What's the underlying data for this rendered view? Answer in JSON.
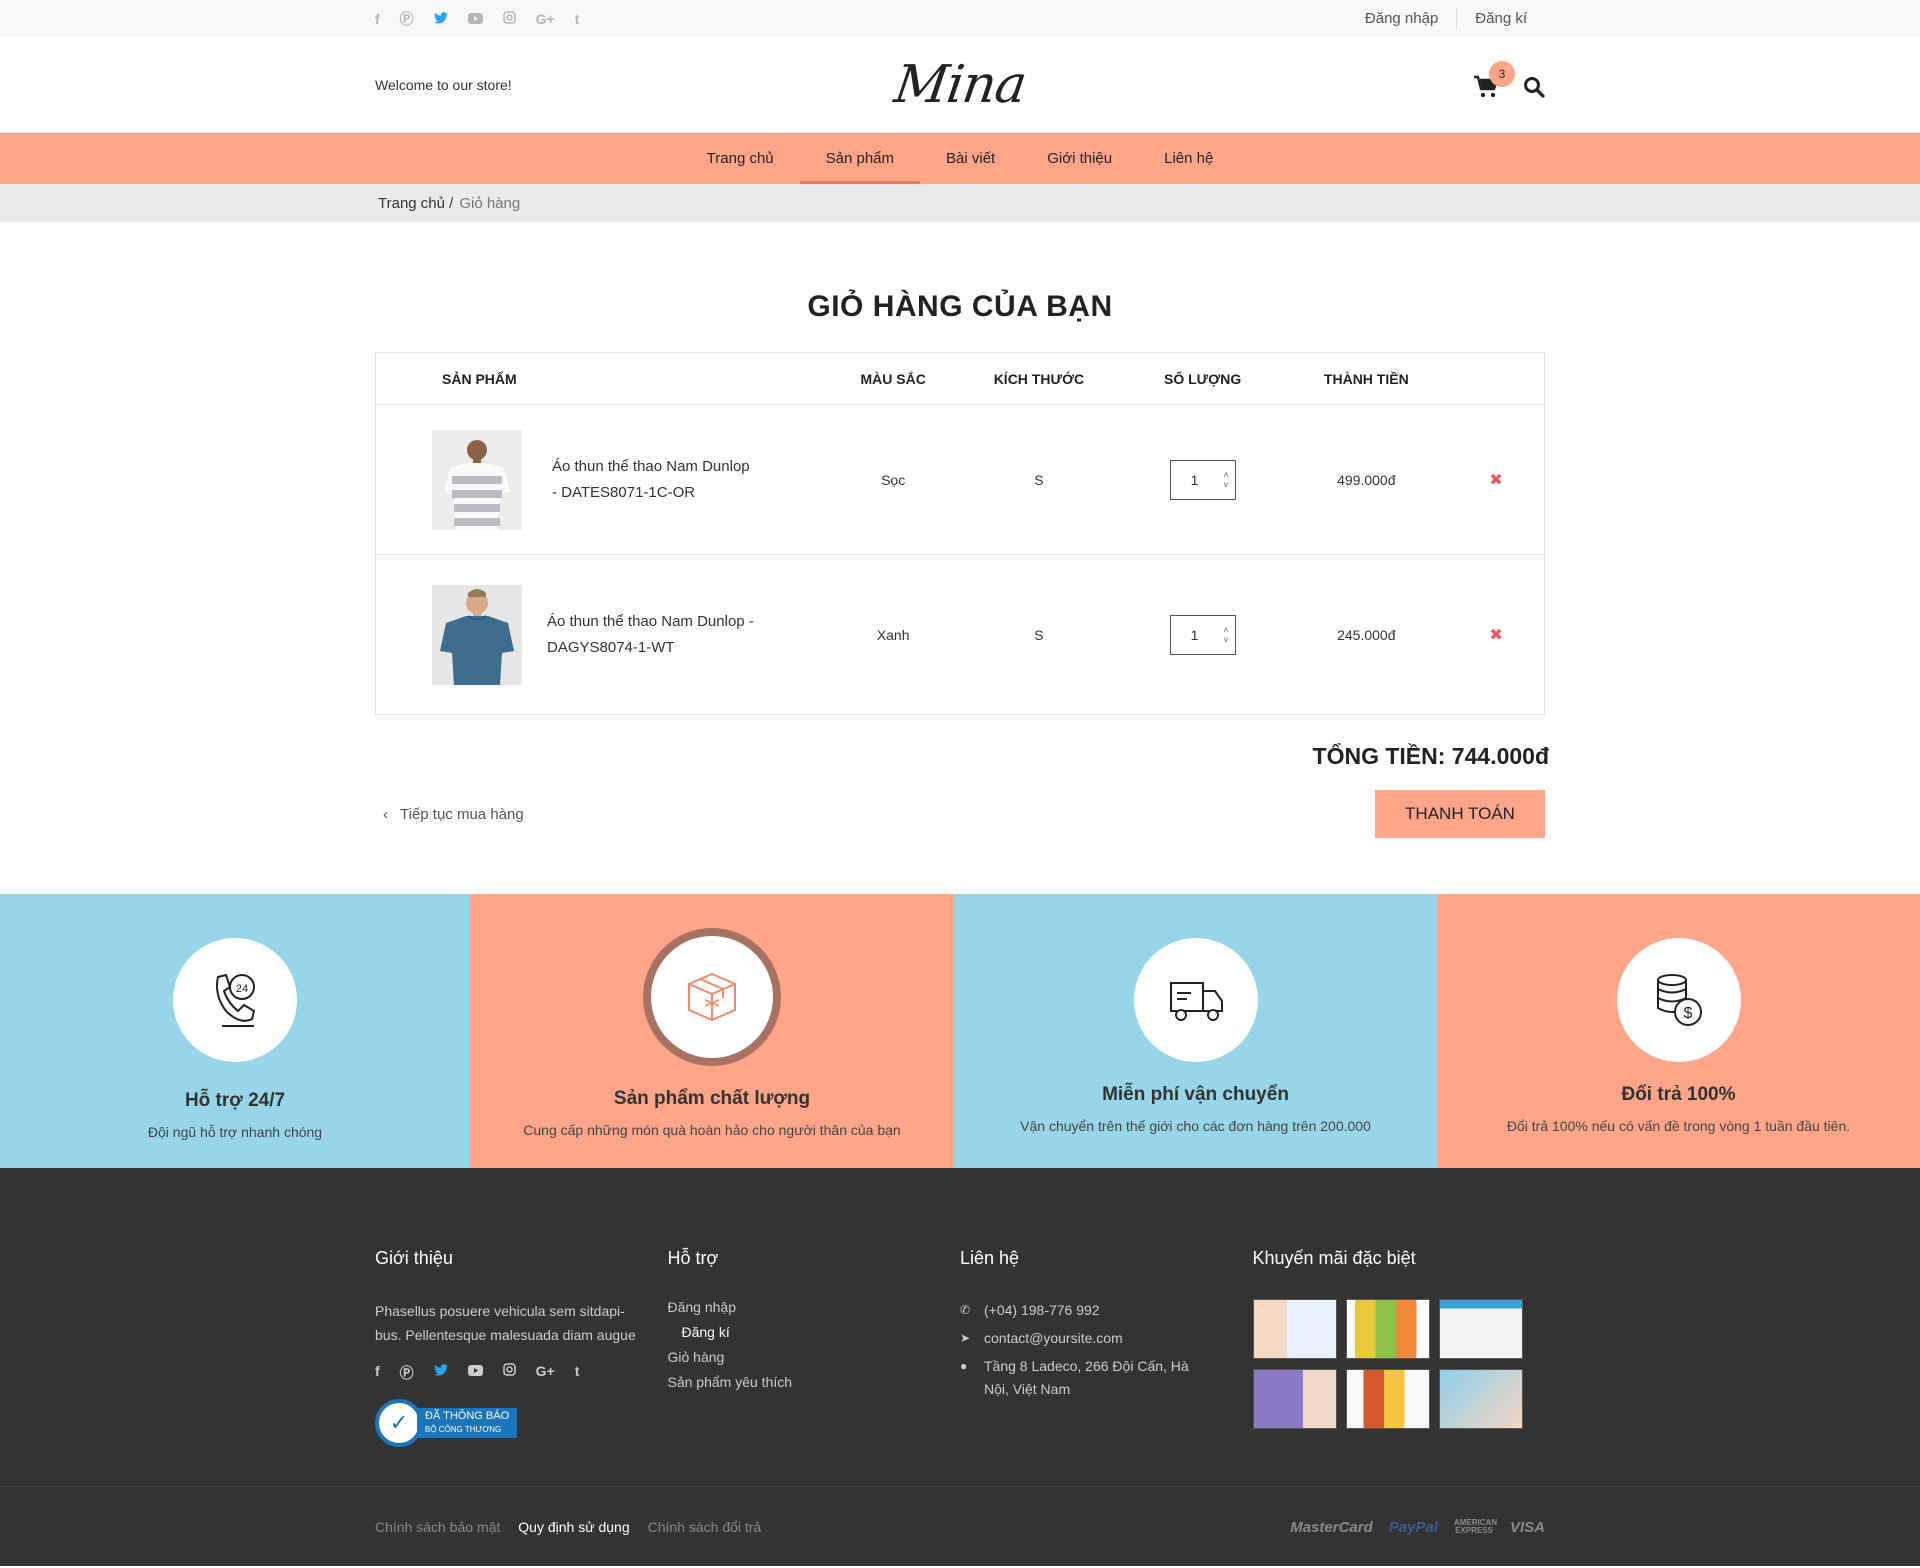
{
  "topbar": {
    "social_icons": [
      "facebook-icon",
      "pinterest-icon",
      "twitter-icon",
      "youtube-icon",
      "instagram-icon",
      "google-plus-icon",
      "tumblr-icon"
    ],
    "login": "Đăng nhập",
    "register": "Đăng kí"
  },
  "header": {
    "welcome": "Welcome to our store!",
    "logo": "Mina",
    "cart_count": "3"
  },
  "nav": {
    "items": [
      "Trang chủ",
      "Sản phẩm",
      "Bài viết",
      "Giới thiệu",
      "Liên hệ"
    ],
    "active": "Sản phẩm"
  },
  "breadcrumb": {
    "home": "Trang chủ /",
    "current": "Giỏ hàng"
  },
  "cart": {
    "title": "GIỎ HÀNG CỦA BẠN",
    "headers": {
      "product": "SẢN PHẨM",
      "color": "MÀU SẮC",
      "size": "KÍCH THƯỚC",
      "qty": "SỐ LƯỢNG",
      "total": "THÀNH TIỀN"
    },
    "rows": [
      {
        "name": "Áo thun thể thao Nam Dunlop - DATES8071-1C-OR",
        "color": "Sọc",
        "size": "S",
        "qty": "1",
        "price": "499.000đ"
      },
      {
        "name": "Áo thun thể thao Nam Dunlop - DAGYS8074-1-WT",
        "color": "Xanh",
        "size": "S",
        "qty": "1",
        "price": "245.000đ"
      }
    ],
    "total": "TỔNG TIỀN: 744.000đ",
    "continue": "Tiếp tục mua hàng",
    "checkout": "THANH TOÁN"
  },
  "features": [
    {
      "title": "Hỗ trợ 24/7",
      "desc": "Đội ngũ hỗ trợ nhanh chóng"
    },
    {
      "title": "Sản phẩm chất lượng",
      "desc": "Cung cấp những món quà hoàn hảo cho người thân của bạn"
    },
    {
      "title": "Miễn phí vận chuyển",
      "desc": "Vận chuyển trên thế giới cho các đơn hàng trên  200.000"
    },
    {
      "title": "Đổi trả 100%",
      "desc": "Đổi trả 100% nếu có vấn đề trong vòng 1 tuần đầu tiên."
    }
  ],
  "footer": {
    "about": {
      "title": "Giới thiệu",
      "text": "Phasellus posuere vehicula sem sitdapi-bus. Pellentesque malesuada diam augue",
      "badge_main": "ĐÃ THÔNG BÁO",
      "badge_sub": "BỘ CÔNG THƯƠNG"
    },
    "support": {
      "title": "Hỗ trợ",
      "links": [
        "Đăng nhập",
        "Đăng kí",
        "Giỏ hàng",
        "Sản phẩm yêu thích"
      ]
    },
    "contact": {
      "title": "Liên hệ",
      "phone": "(+04) 198-776 992",
      "email": "contact@yoursite.com",
      "address": "Tầng 8 Ladeco, 266 Đội Cấn, Hà Nội, Việt Nam"
    },
    "promo": {
      "title": "Khuyến mãi đặc biệt"
    },
    "policies": [
      "Chính sách bảo mật",
      "Quy định sử dụng",
      "Chính sách đổi trả"
    ],
    "payments": [
      "MasterCard",
      "PayPal",
      "AMERICAN EXPRESS",
      "VISA"
    ]
  },
  "colors": {
    "accent": "#ffa589",
    "light_blue": "#98d5e9",
    "footer_bg": "#333333",
    "delete": "#e8595e"
  }
}
